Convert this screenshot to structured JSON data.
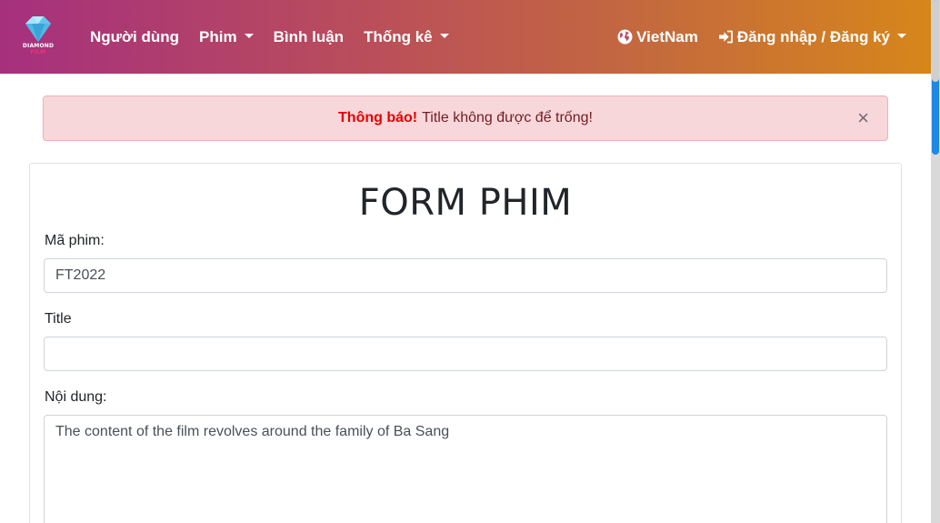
{
  "brand": {
    "logo_line1": "DIAMOND",
    "logo_line2": "FILM"
  },
  "nav": {
    "items": [
      {
        "label": "Người dùng"
      },
      {
        "label": "Phim"
      },
      {
        "label": "Bình luận"
      },
      {
        "label": "Thống kê"
      }
    ],
    "language": "VietNam",
    "account": "Đăng nhập / Đăng ký"
  },
  "alert": {
    "title": "Thông báo!",
    "message": "Title không được để trống!",
    "close": "×"
  },
  "form": {
    "title": "FORM PHIM",
    "fields": [
      {
        "label": "Mã phim:",
        "value": "FT2022"
      },
      {
        "label": "Title",
        "value": ""
      },
      {
        "label": "Nội dung:",
        "value": "The content of the film revolves around the family of Ba Sang"
      }
    ]
  },
  "colors": {
    "navbar_gradient_start": "#a5307e",
    "navbar_gradient_end": "#d7861a",
    "alert_background": "#f8d7da",
    "alert_title": "#e60000"
  }
}
